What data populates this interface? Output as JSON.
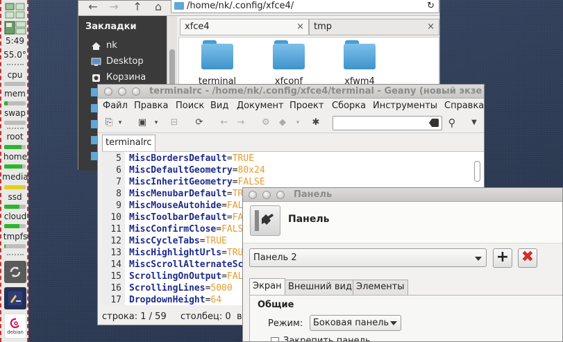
{
  "left_panel": {
    "clock": "5:49",
    "temperature": "55.0°",
    "monitors": [
      {
        "label": "cpu",
        "level": 0.0
      },
      {
        "label": "mem",
        "level": 0.15
      },
      {
        "label": "swap",
        "level": 0.0
      },
      {
        "label": "root",
        "level": 0.82
      },
      {
        "label": "home",
        "level": 0.85
      },
      {
        "label": "media",
        "level": 0.95,
        "color": "#e4d01a"
      },
      {
        "label": "ssd",
        "level": 0.7
      },
      {
        "label": "cloud",
        "level": 0.72
      },
      {
        "label": "tmpfs",
        "level": 0.05
      }
    ],
    "launchers": [
      "refresh-icon",
      "script-editor-icon",
      "debian-icon"
    ],
    "debian_label": "debian"
  },
  "thunar": {
    "path": "/home/nk/.config/xfce4/",
    "sidebar_title": "Закладки",
    "sidebar_items": [
      "nk",
      "Desktop",
      "Корзина"
    ],
    "tabs": [
      "xfce4",
      "tmp"
    ],
    "tab_close": "×",
    "files": [
      "terminal",
      "xfconf",
      "xfwm4"
    ]
  },
  "geany": {
    "title": "terminalrc - /home/nk/.config/xfce4/terminal - Geany (новый экзе",
    "menu": [
      "Файл",
      "Правка",
      "Поиск",
      "Вид",
      "Документ",
      "Проект",
      "Сборка",
      "Инструменты",
      "Справка"
    ],
    "tab": "terminalrc",
    "lines": [
      {
        "n": "5",
        "key": "MiscBordersDefault",
        "value": "TRUE"
      },
      {
        "n": "6",
        "key": "MiscDefaultGeometry",
        "value": "80x24"
      },
      {
        "n": "7",
        "key": "MiscInheritGeometry",
        "value": "FALSE"
      },
      {
        "n": "8",
        "key": "MiscMenubarDefault",
        "value": "TR"
      },
      {
        "n": "9",
        "key": "MiscMouseAutohide",
        "value": "FAL"
      },
      {
        "n": "10",
        "key": "MiscToolbarDefault",
        "value": "FA"
      },
      {
        "n": "11",
        "key": "MiscConfirmClose",
        "value": "FALS"
      },
      {
        "n": "12",
        "key": "MiscCycleTabs",
        "value": "TRUE"
      },
      {
        "n": "13",
        "key": "MiscHighlightUrls",
        "value": "TRU"
      },
      {
        "n": "14",
        "key": "MiscScrollAlternateSc",
        "value": ""
      },
      {
        "n": "15",
        "key": "ScrollingOnOutput",
        "value": "FAL"
      },
      {
        "n": "16",
        "key": "ScrollingLines",
        "value": "5000"
      },
      {
        "n": "17",
        "key": "DropdownHeight",
        "value": "64"
      }
    ],
    "status_line": "строка: 1 / 59",
    "status_col": "столбец: 0",
    "status_extra": "в"
  },
  "panel_prefs": {
    "title": "Панель",
    "heading": "Панель",
    "selected_panel": "Панель 2",
    "tabs": [
      "Экран",
      "Внешний вид",
      "Элементы"
    ],
    "group_title": "Общие",
    "mode_label": "Режим:",
    "mode_value": "Боковая панель",
    "lock_label": "Закрепить панель"
  }
}
